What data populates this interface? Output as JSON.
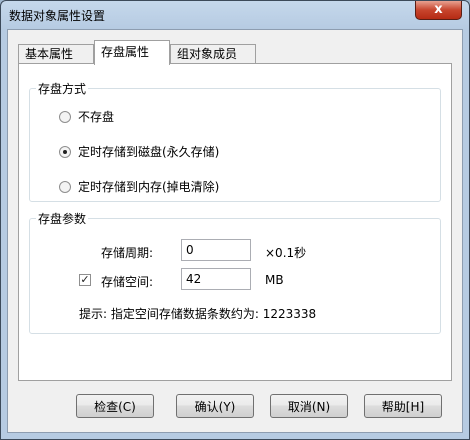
{
  "window": {
    "title": "数据对象属性设置",
    "close_glyph": "x"
  },
  "tabs": [
    {
      "label": "基本属性",
      "active": false
    },
    {
      "label": "存盘属性",
      "active": true
    },
    {
      "label": "组对象成员",
      "active": false
    }
  ],
  "storage_mode": {
    "legend": "存盘方式",
    "options": [
      {
        "label": "不存盘",
        "checked": false
      },
      {
        "label": "定时存储到磁盘(永久存储)",
        "checked": true
      },
      {
        "label": "定时存储到内存(掉电清除)",
        "checked": false
      }
    ]
  },
  "storage_params": {
    "legend": "存盘参数",
    "period_label": "存储周期:",
    "period_value": "0",
    "period_unit": "×0.1秒",
    "space_check": "✓",
    "space_label": "存储空间:",
    "space_value": "42",
    "space_unit": "MB",
    "hint": "提示: 指定空间存储数据条数约为: 1223338"
  },
  "buttons": {
    "check": "检查(C)",
    "confirm": "确认(Y)",
    "cancel": "取消(N)",
    "help": "帮助[H]"
  },
  "colors": {
    "title_bar": "#b6cbe2",
    "close_button": "#c7452d"
  }
}
